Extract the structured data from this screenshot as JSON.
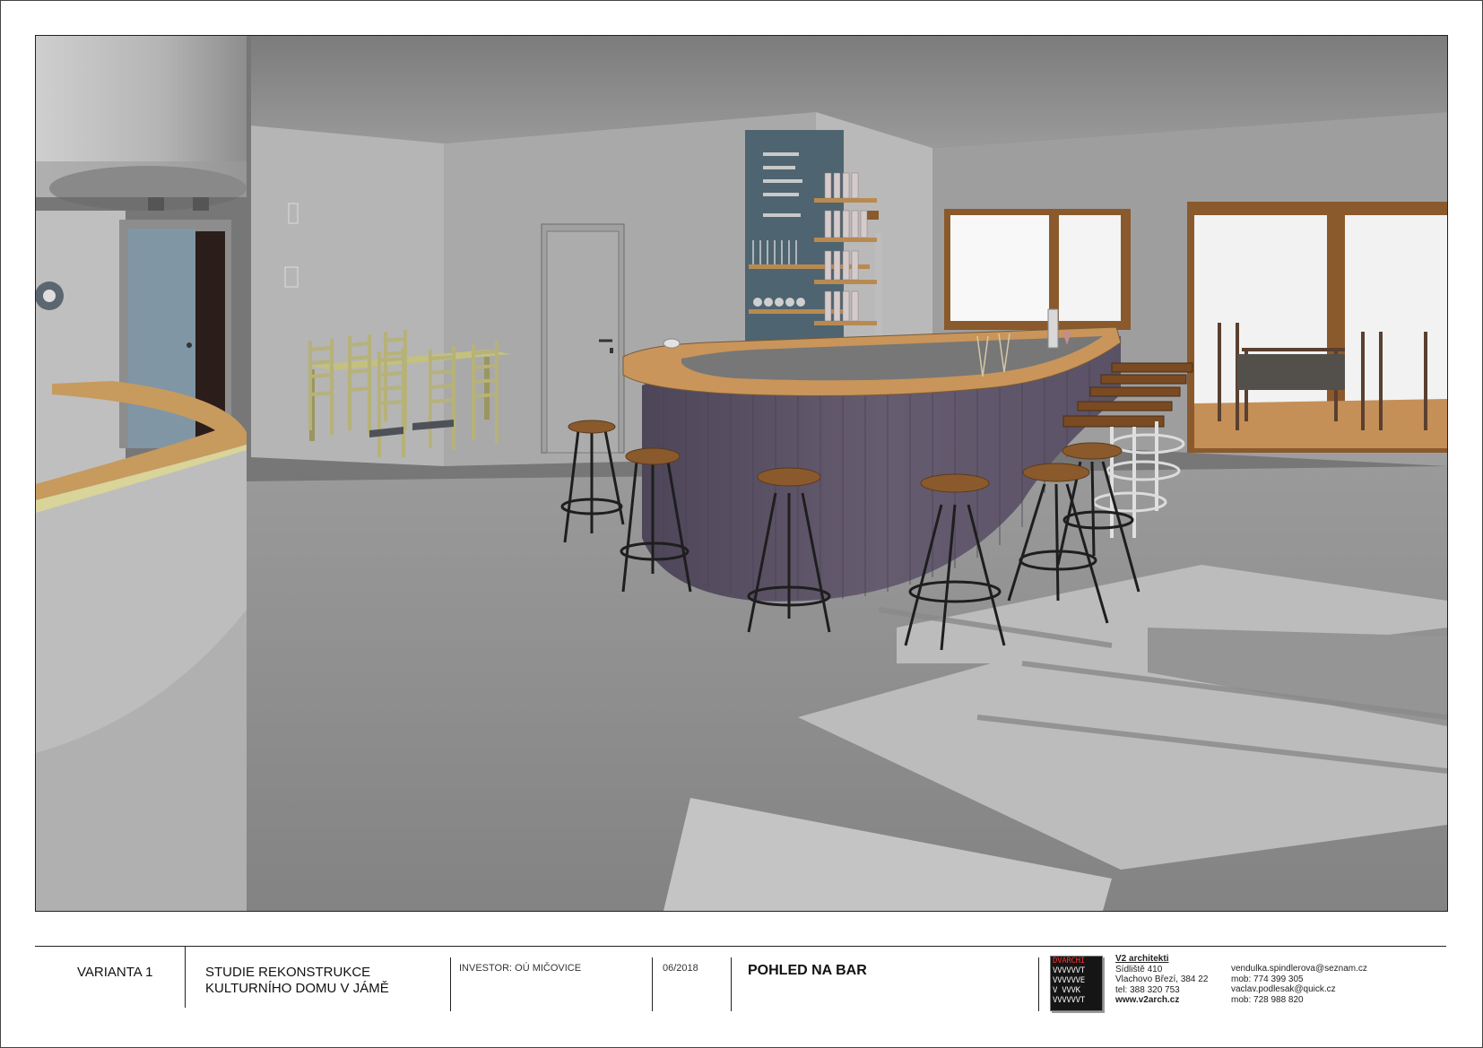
{
  "title_block": {
    "variant": "VARIANTA 1",
    "study_line1": "STUDIE REKONSTRUKCE",
    "study_line2": "KULTURNÍHO DOMU V JÁMĚ",
    "investor": "INVESTOR: OÚ MIČOVICE",
    "date": "06/2018",
    "view_title": "POHLED NA BAR"
  },
  "logo": {
    "lines": [
      "DVARCHI",
      "VVVVVVT",
      "VVVVVVE",
      "V VVVK",
      "VVVVVVT",
      "VVVVVVI"
    ]
  },
  "firm": {
    "name": "V2 architekti",
    "address1": "Sídliště 410",
    "address2": "Vlachovo Březí, 384 22",
    "phone": "tel: 388 320 753",
    "web": "www.v2arch.cz"
  },
  "contacts": {
    "email1": "vendulka.spindlerova@seznam.cz",
    "mobile1": "mob: 774 399 305",
    "email2": "vaclav.podlesak@quick.cz",
    "mobile2": "mob: 728 988 820"
  },
  "colors": {
    "bar_front": "#5d5468",
    "wood_top": "#c9955a",
    "stool_seat": "#8a5a2c",
    "wall": "#a8a8a8",
    "floor": "#8f8f8f",
    "backwall_panel": "#4e6470",
    "chairs": "#b8b585"
  }
}
